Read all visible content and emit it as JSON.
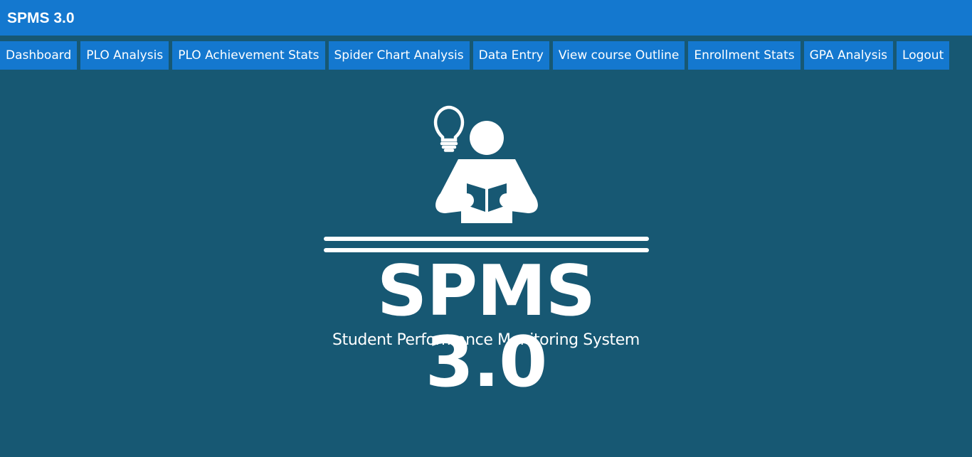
{
  "header": {
    "app_title": "SPMS 3.0"
  },
  "nav": {
    "items": [
      {
        "label": "Dashboard"
      },
      {
        "label": "PLO Analysis"
      },
      {
        "label": "PLO Achievement Stats"
      },
      {
        "label": "Spider Chart Analysis"
      },
      {
        "label": "Data Entry"
      },
      {
        "label": "View course Outline"
      },
      {
        "label": "Enrollment Stats"
      },
      {
        "label": "GPA Analysis"
      },
      {
        "label": "Logout"
      }
    ]
  },
  "logo": {
    "title": "SPMS 3.0",
    "subtitle": "Student Performance Monitoring System",
    "icons": [
      "lightbulb-icon",
      "student-reading-icon"
    ]
  },
  "colors": {
    "background": "#175873",
    "bar": "#1478cf",
    "text": "#ffffff"
  }
}
